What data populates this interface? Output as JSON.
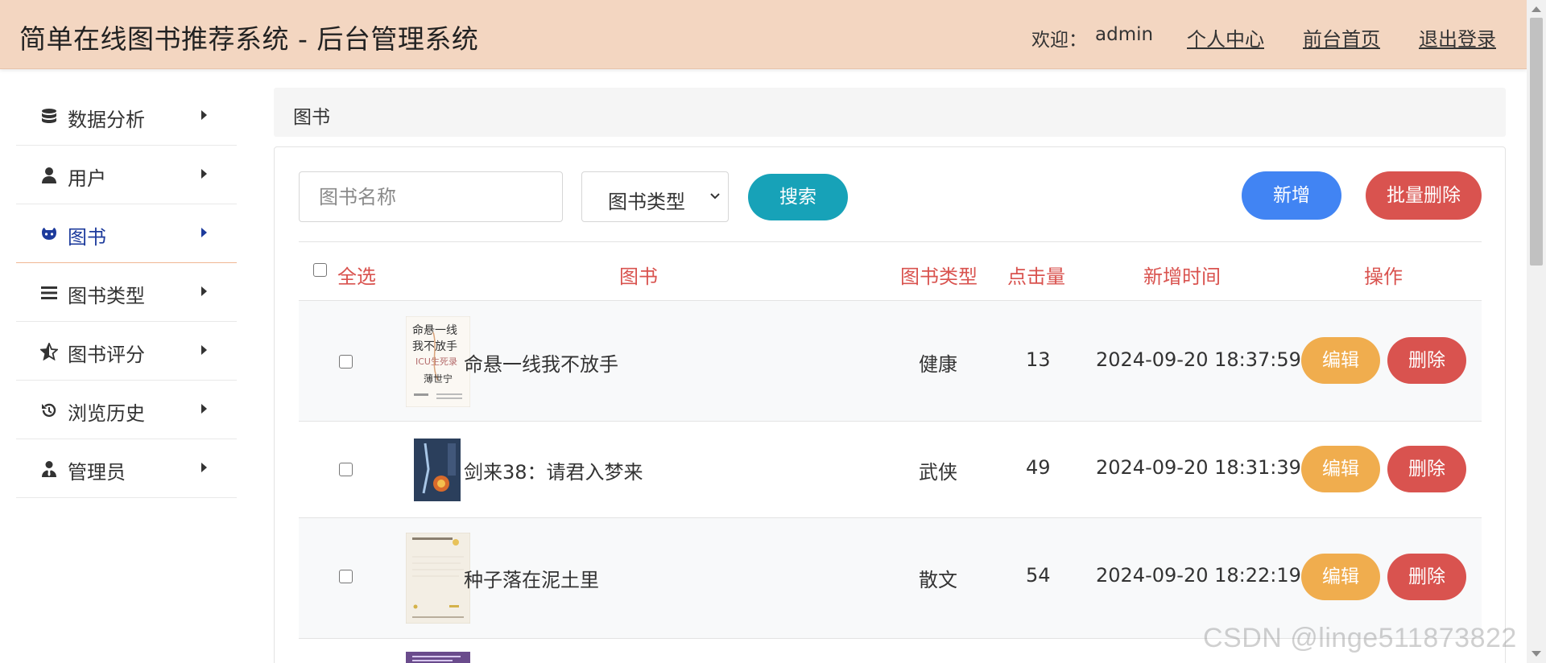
{
  "header": {
    "title": "简单在线图书推荐系统 - 后台管理系统",
    "welcome_label": "欢迎：",
    "username": "admin",
    "links": [
      "个人中心",
      "前台首页",
      "退出登录"
    ],
    "background": "#f3d6c1"
  },
  "sidebar": {
    "items": [
      {
        "label": "数据分析",
        "icon": "database-icon"
      },
      {
        "label": "用户",
        "icon": "user-icon"
      },
      {
        "label": "图书",
        "icon": "github-icon",
        "active": true
      },
      {
        "label": "图书类型",
        "icon": "list-icon"
      },
      {
        "label": "图书评分",
        "icon": "star-half-icon"
      },
      {
        "label": "浏览历史",
        "icon": "history-icon"
      },
      {
        "label": "管理员",
        "icon": "user-tie-icon"
      }
    ]
  },
  "breadcrumb": {
    "current": "图书"
  },
  "search": {
    "name_placeholder": "图书名称",
    "type_select_value": "图书类型",
    "search_label": "搜索",
    "add_label": "新增",
    "batch_delete_label": "批量删除"
  },
  "table": {
    "select_all_label": "全选",
    "columns": [
      "图书",
      "图书类型",
      "点击量",
      "新增时间",
      "操作"
    ],
    "rows": [
      {
        "name": "命悬一线我不放手",
        "type": "健康",
        "clicks": "13",
        "time": "2024-09-20 18:37:59",
        "cover_text": [
          "命悬一线",
          "我不放手",
          "ICU生死录",
          "薄世宁"
        ]
      },
      {
        "name": "剑来38：请君入梦来",
        "type": "武侠",
        "clicks": "49",
        "time": "2024-09-20 18:31:39",
        "cover_text": []
      },
      {
        "name": "种子落在泥土里",
        "type": "散文",
        "clicks": "54",
        "time": "2024-09-20 18:22:19",
        "cover_text": []
      }
    ],
    "edit_label": "编辑",
    "delete_label": "删除"
  },
  "colors": {
    "accent_blue": "#4184f3",
    "info": "#17a2b8",
    "danger": "#d9534f",
    "warning": "#f0ad4e",
    "active_nav": "#1d3b9c"
  },
  "watermark": "CSDN @linge511873822"
}
